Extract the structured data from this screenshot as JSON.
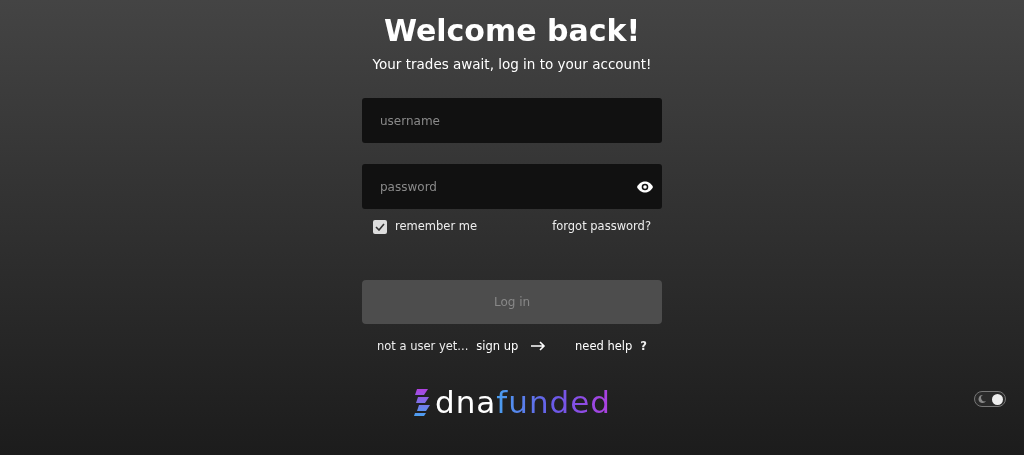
{
  "title": "Welcome back!",
  "subtitle": "Your trades await, log in to your account!",
  "username_field": {
    "placeholder": "username"
  },
  "password_field": {
    "placeholder": "password"
  },
  "remember_me": {
    "label": "remember me",
    "checked": true
  },
  "forgot_password": "forgot password?",
  "login_button": {
    "label": "Log in",
    "disabled": true
  },
  "signup_prompt": "not a user yet...",
  "signup_link": "sign up",
  "help_link": "need help",
  "help_mark": "?",
  "logo": {
    "part_1": "dna",
    "part_2": "funded"
  },
  "theme_toggle": {
    "on": true
  }
}
